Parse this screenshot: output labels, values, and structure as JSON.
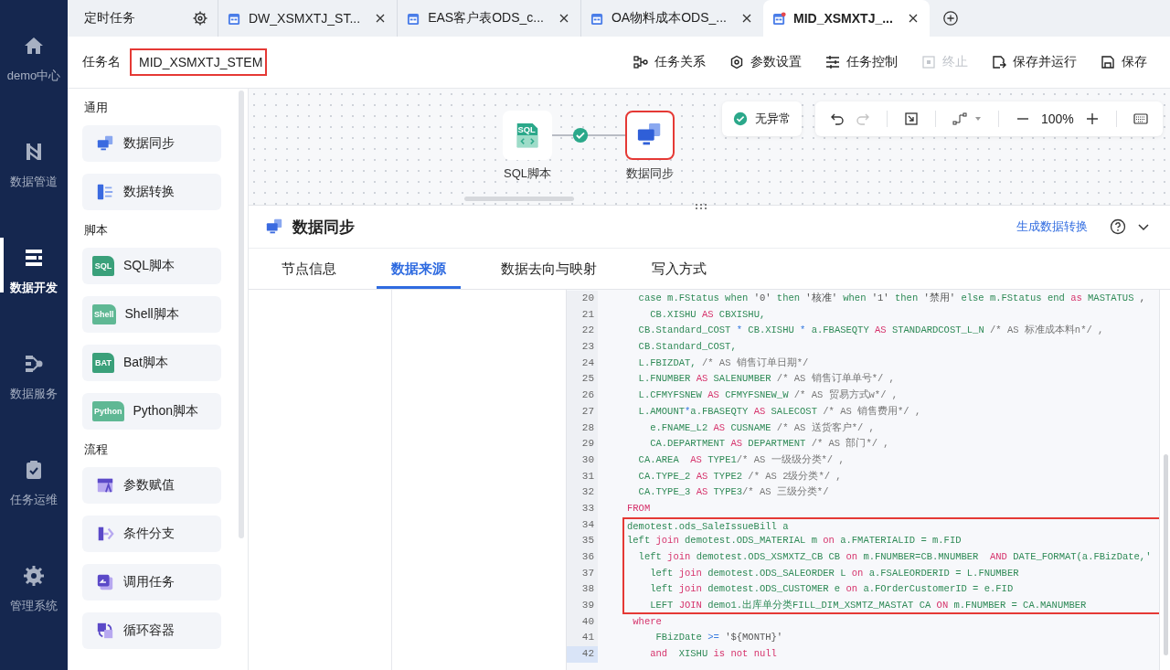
{
  "nav": [
    {
      "label": "demo中心",
      "kind": "home",
      "selected": false
    },
    {
      "label": "数据管道",
      "kind": "pipeline",
      "selected": false
    },
    {
      "label": "数据开发",
      "kind": "dev",
      "selected": true
    },
    {
      "label": "数据服务",
      "kind": "service",
      "selected": false
    },
    {
      "label": "任务运维",
      "kind": "ops",
      "selected": false
    },
    {
      "label": "管理系统",
      "kind": "admin",
      "selected": false
    }
  ],
  "schedule_tab": {
    "label": "定时任务"
  },
  "tabs": [
    {
      "label": "DW_XSMXTJ_ST...",
      "selected": false,
      "modified": false
    },
    {
      "label": "EAS客户表ODS_c...",
      "selected": false,
      "modified": false
    },
    {
      "label": "OA物料成本ODS_...",
      "selected": false,
      "modified": false
    },
    {
      "label": "MID_XSMXTJ_...",
      "selected": true,
      "modified": true
    }
  ],
  "task": {
    "label": "任务名",
    "value": "MID_XSMXTJ_STEM"
  },
  "actions": [
    {
      "label": "任务关系",
      "kind": "relation",
      "disabled": false
    },
    {
      "label": "参数设置",
      "kind": "settings",
      "disabled": false
    },
    {
      "label": "任务控制",
      "kind": "control",
      "disabled": false
    },
    {
      "label": "终止",
      "kind": "stop",
      "disabled": true
    },
    {
      "label": "保存并运行",
      "kind": "run",
      "disabled": false
    },
    {
      "label": "保存",
      "kind": "save",
      "disabled": false
    }
  ],
  "palette": [
    {
      "title": "通用",
      "items": [
        {
          "label": "数据同步",
          "kind": "sync"
        },
        {
          "label": "数据转换",
          "kind": "transform"
        }
      ]
    },
    {
      "title": "脚本",
      "items": [
        {
          "label": "SQL脚本",
          "kind": "script",
          "icon_text": "SQL"
        },
        {
          "label": "Shell脚本",
          "kind": "script",
          "icon_text": "Shell"
        },
        {
          "label": "Bat脚本",
          "kind": "script",
          "icon_text": "BAT"
        },
        {
          "label": "Python脚本",
          "kind": "script",
          "icon_text": "Python"
        }
      ]
    },
    {
      "title": "流程",
      "items": [
        {
          "label": "参数赋值",
          "kind": "param"
        },
        {
          "label": "条件分支",
          "kind": "branch"
        },
        {
          "label": "调用任务",
          "kind": "call"
        },
        {
          "label": "循环容器",
          "kind": "loop"
        }
      ]
    }
  ],
  "canvas": {
    "nodes": [
      {
        "label": "SQL脚本",
        "kind": "sql",
        "icon_text": "SQL",
        "selected": false
      },
      {
        "label": "数据同步",
        "kind": "sync",
        "selected": true
      }
    ],
    "status": "无异常",
    "zoom": "100%",
    "redo_disabled": true
  },
  "panel": {
    "title": "数据同步",
    "link": "生成数据转换",
    "tabs": [
      {
        "label": "节点信息",
        "selected": false
      },
      {
        "label": "数据来源",
        "selected": true
      },
      {
        "label": "数据去向与映射",
        "selected": false
      },
      {
        "label": "写入方式",
        "selected": false
      }
    ]
  },
  "code": [
    {
      "n": "20",
      "highlighted": false,
      "current": false,
      "segs": [
        {
          "kind": "id",
          "text": "  case m.FStatus when "
        },
        {
          "kind": "str",
          "text": "'0'"
        },
        {
          "kind": "id",
          "text": " then "
        },
        {
          "kind": "str",
          "text": "'核准'"
        },
        {
          "kind": "id",
          "text": " when "
        },
        {
          "kind": "str",
          "text": "'1'"
        },
        {
          "kind": "id",
          "text": " then "
        },
        {
          "kind": "str",
          "text": "'禁用'"
        },
        {
          "kind": "id",
          "text": " else m.FStatus end "
        },
        {
          "kind": "kw",
          "text": "as"
        },
        {
          "kind": "id",
          "text": " MASTATUS "
        },
        {
          "kind": "str",
          "text": ","
        }
      ]
    },
    {
      "n": "21",
      "highlighted": false,
      "current": false,
      "segs": [
        {
          "kind": "id",
          "text": "    CB.XISHU "
        },
        {
          "kind": "kw",
          "text": "AS"
        },
        {
          "kind": "id",
          "text": " CBXISHU,"
        }
      ]
    },
    {
      "n": "22",
      "highlighted": false,
      "current": false,
      "segs": [
        {
          "kind": "id",
          "text": "  CB.Standard_COST "
        },
        {
          "kind": "op",
          "text": "*"
        },
        {
          "kind": "id",
          "text": " CB.XISHU "
        },
        {
          "kind": "op",
          "text": "*"
        },
        {
          "kind": "id",
          "text": " a.FBASEQTY "
        },
        {
          "kind": "kw",
          "text": "AS"
        },
        {
          "kind": "id",
          "text": " STANDARDCOST_L_N "
        },
        {
          "kind": "cm",
          "text": "/* AS 标准成本料n*/ ,"
        }
      ]
    },
    {
      "n": "23",
      "highlighted": false,
      "current": false,
      "segs": [
        {
          "kind": "id",
          "text": "  CB.Standard_COST,"
        }
      ]
    },
    {
      "n": "24",
      "highlighted": false,
      "current": false,
      "segs": [
        {
          "kind": "id",
          "text": "  L.FBIZDAT, "
        },
        {
          "kind": "cm",
          "text": "/* AS 销售订单日期*/"
        }
      ]
    },
    {
      "n": "25",
      "highlighted": false,
      "current": false,
      "segs": [
        {
          "kind": "id",
          "text": "  L.FNUMBER "
        },
        {
          "kind": "kw",
          "text": "AS"
        },
        {
          "kind": "id",
          "text": " SALENUMBER "
        },
        {
          "kind": "cm",
          "text": "/* AS 销售订单单号*/ ,"
        }
      ]
    },
    {
      "n": "26",
      "highlighted": false,
      "current": false,
      "segs": [
        {
          "kind": "id",
          "text": "  L.CFMYFSNEW "
        },
        {
          "kind": "kw",
          "text": "AS"
        },
        {
          "kind": "id",
          "text": " CFMYFSNEW_W "
        },
        {
          "kind": "cm",
          "text": "/* AS 贸易方式w*/ ,"
        }
      ]
    },
    {
      "n": "27",
      "highlighted": false,
      "current": false,
      "segs": [
        {
          "kind": "id",
          "text": "  L.AMOUNT"
        },
        {
          "kind": "op",
          "text": "*"
        },
        {
          "kind": "id",
          "text": "a.FBASEQTY "
        },
        {
          "kind": "kw",
          "text": "AS"
        },
        {
          "kind": "id",
          "text": " SALECOST "
        },
        {
          "kind": "cm",
          "text": "/* AS 销售费用*/ ,"
        }
      ]
    },
    {
      "n": "28",
      "highlighted": false,
      "current": false,
      "segs": [
        {
          "kind": "id",
          "text": "    e.FNAME_L2 "
        },
        {
          "kind": "kw",
          "text": "AS"
        },
        {
          "kind": "id",
          "text": " CUSNAME "
        },
        {
          "kind": "cm",
          "text": "/* AS 送货客户*/ ,"
        }
      ]
    },
    {
      "n": "29",
      "highlighted": false,
      "current": false,
      "segs": [
        {
          "kind": "id",
          "text": "    CA.DEPARTMENT "
        },
        {
          "kind": "kw",
          "text": "AS"
        },
        {
          "kind": "id",
          "text": " DEPARTMENT "
        },
        {
          "kind": "cm",
          "text": "/* AS 部门*/ ,"
        }
      ]
    },
    {
      "n": "30",
      "highlighted": false,
      "current": false,
      "segs": [
        {
          "kind": "id",
          "text": "  CA.AREA  "
        },
        {
          "kind": "kw",
          "text": "AS"
        },
        {
          "kind": "id",
          "text": " TYPE1"
        },
        {
          "kind": "cm",
          "text": "/* AS 一级级分类*/ ,"
        }
      ]
    },
    {
      "n": "31",
      "highlighted": false,
      "current": false,
      "segs": [
        {
          "kind": "id",
          "text": "  CA.TYPE_2 "
        },
        {
          "kind": "kw",
          "text": "AS"
        },
        {
          "kind": "id",
          "text": " TYPE2 "
        },
        {
          "kind": "cm",
          "text": "/* AS 2级分类*/ ,"
        }
      ]
    },
    {
      "n": "32",
      "highlighted": false,
      "current": false,
      "segs": [
        {
          "kind": "id",
          "text": "  CA.TYPE_3 "
        },
        {
          "kind": "kw",
          "text": "AS"
        },
        {
          "kind": "id",
          "text": " TYPE3"
        },
        {
          "kind": "cm",
          "text": "/* AS 三级分类*/"
        }
      ]
    },
    {
      "n": "33",
      "highlighted": false,
      "current": false,
      "segs": [
        {
          "kind": "kw",
          "text": "FROM"
        }
      ]
    },
    {
      "n": "34",
      "highlighted": true,
      "current": false,
      "segs": [
        {
          "kind": "id",
          "text": "demotest.ods_SaleIssueBill a"
        }
      ]
    },
    {
      "n": "35",
      "highlighted": true,
      "current": false,
      "segs": [
        {
          "kind": "id",
          "text": "left "
        },
        {
          "kind": "kw",
          "text": "join"
        },
        {
          "kind": "id",
          "text": " demotest.ODS_MATERIAL m "
        },
        {
          "kind": "kw",
          "text": "on"
        },
        {
          "kind": "id",
          "text": " a.FMATERIALID = m.FID"
        }
      ]
    },
    {
      "n": "36",
      "highlighted": true,
      "current": false,
      "segs": [
        {
          "kind": "id",
          "text": "  left "
        },
        {
          "kind": "kw",
          "text": "join"
        },
        {
          "kind": "id",
          "text": " demotest.ODS_XSMXTZ_CB CB "
        },
        {
          "kind": "kw",
          "text": "on"
        },
        {
          "kind": "id",
          "text": " m.FNUMBER=CB.MNUMBER  "
        },
        {
          "kind": "kw",
          "text": "AND"
        },
        {
          "kind": "id",
          "text": " DATE_FORMAT(a.FBizDate,'"
        }
      ]
    },
    {
      "n": "37",
      "highlighted": true,
      "current": false,
      "segs": [
        {
          "kind": "id",
          "text": "    left "
        },
        {
          "kind": "kw",
          "text": "join"
        },
        {
          "kind": "id",
          "text": " demotest.ODS_SALEORDER L "
        },
        {
          "kind": "kw",
          "text": "on"
        },
        {
          "kind": "id",
          "text": " a.FSALEORDERID = L.FNUMBER"
        }
      ]
    },
    {
      "n": "38",
      "highlighted": true,
      "current": false,
      "segs": [
        {
          "kind": "id",
          "text": "    left "
        },
        {
          "kind": "kw",
          "text": "join"
        },
        {
          "kind": "id",
          "text": " demotest.ODS_CUSTOMER e "
        },
        {
          "kind": "kw",
          "text": "on"
        },
        {
          "kind": "id",
          "text": " a.FOrderCustomerID = e.FID"
        }
      ]
    },
    {
      "n": "39",
      "highlighted": true,
      "current": false,
      "segs": [
        {
          "kind": "id",
          "text": "    LEFT "
        },
        {
          "kind": "kw",
          "text": "JOIN"
        },
        {
          "kind": "id",
          "text": " demo1.出库单分类FILL_DIM_XSMTZ_MASTAT CA "
        },
        {
          "kind": "kw",
          "text": "ON"
        },
        {
          "kind": "id",
          "text": " m.FNUMBER = CA.MANUMBER"
        }
      ]
    },
    {
      "n": "40",
      "highlighted": false,
      "current": false,
      "segs": [
        {
          "kind": "kw",
          "text": " where"
        }
      ]
    },
    {
      "n": "41",
      "highlighted": false,
      "current": false,
      "segs": [
        {
          "kind": "id",
          "text": "     FBizDate "
        },
        {
          "kind": "op",
          "text": ">="
        },
        {
          "kind": "str",
          "text": " '${MONTH}'"
        }
      ]
    },
    {
      "n": "42",
      "highlighted": false,
      "current": true,
      "segs": [
        {
          "kind": "kw",
          "text": "    and"
        },
        {
          "kind": "id",
          "text": "  XISHU "
        },
        {
          "kind": "kw",
          "text": "is not null"
        }
      ]
    }
  ]
}
